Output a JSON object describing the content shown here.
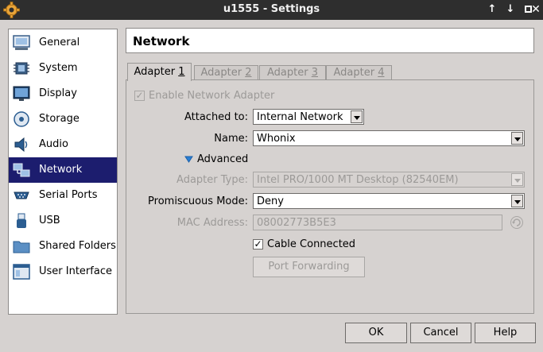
{
  "window": {
    "title": "u1555 - Settings"
  },
  "sidebar": {
    "items": [
      {
        "label": "General",
        "icon": "general-icon"
      },
      {
        "label": "System",
        "icon": "chip-icon"
      },
      {
        "label": "Display",
        "icon": "monitor-icon"
      },
      {
        "label": "Storage",
        "icon": "disk-icon"
      },
      {
        "label": "Audio",
        "icon": "speaker-icon"
      },
      {
        "label": "Network",
        "icon": "network-icon",
        "selected": true
      },
      {
        "label": "Serial Ports",
        "icon": "serial-port-icon"
      },
      {
        "label": "USB",
        "icon": "usb-icon"
      },
      {
        "label": "Shared Folders",
        "icon": "folder-icon"
      },
      {
        "label": "User Interface",
        "icon": "window-icon"
      }
    ]
  },
  "section": {
    "title": "Network"
  },
  "tabs": [
    {
      "label_prefix": "Adapter ",
      "label_key": "1",
      "active": true
    },
    {
      "label_prefix": "Adapter ",
      "label_key": "2"
    },
    {
      "label_prefix": "Adapter ",
      "label_key": "3"
    },
    {
      "label_prefix": "Adapter ",
      "label_key": "4"
    }
  ],
  "form": {
    "enable_adapter": {
      "label": "Enable Network Adapter",
      "checked": true,
      "enabled": false
    },
    "attached_to": {
      "label": "Attached to:",
      "value": "Internal Network"
    },
    "name": {
      "label": "Name:",
      "value": "Whonix"
    },
    "advanced": {
      "label": "Advanced",
      "expanded": true
    },
    "adapter_type": {
      "label": "Adapter Type:",
      "value": "Intel PRO/1000 MT Desktop (82540EM)",
      "enabled": false
    },
    "promiscuous_mode": {
      "label": "Promiscuous Mode:",
      "value": "Deny"
    },
    "mac_address": {
      "label": "MAC Address:",
      "value": "08002773B5E3",
      "enabled": false
    },
    "cable_connected": {
      "label": "Cable Connected",
      "checked": true
    },
    "port_forwarding": {
      "label": "Port Forwarding",
      "enabled": false
    }
  },
  "buttons": {
    "ok": "OK",
    "cancel": "Cancel",
    "help": "Help"
  },
  "colors": {
    "selection": "#1c1d6e",
    "titlebar": "#2e2e2e",
    "accent_arrow": "#2a7fd4"
  }
}
